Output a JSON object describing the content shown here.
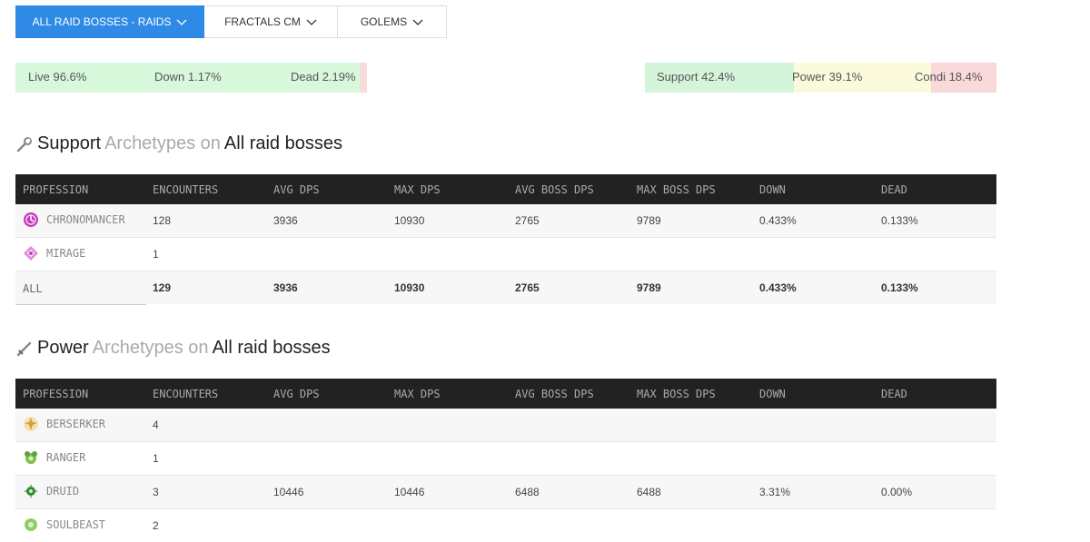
{
  "tabs": [
    {
      "label": "ALL RAID BOSSES - RAIDS",
      "active": true
    },
    {
      "label": "FRACTALS CM",
      "active": false
    },
    {
      "label": "GOLEMS",
      "active": false
    }
  ],
  "status_bar": {
    "live": {
      "label": "Live 96.6%",
      "value": 96.6,
      "color": "#d8f8dc"
    },
    "down": {
      "label": "Down 1.17%",
      "value": 1.17,
      "color": "#d8f8dc"
    },
    "dead": {
      "label": "Dead 2.19%",
      "value": 2.19,
      "color": "#f8dcdc"
    }
  },
  "archetype_bar": {
    "support": {
      "label": "Support 42.4%",
      "value": 42.4,
      "color": "#d4f5da"
    },
    "power": {
      "label": "Power 39.1%",
      "value": 39.1,
      "color": "#fbfbdc"
    },
    "condi": {
      "label": "Condi 18.4%",
      "value": 18.4,
      "color": "#f9d9d9"
    }
  },
  "columns": [
    "PROFESSION",
    "ENCOUNTERS",
    "AVG DPS",
    "MAX DPS",
    "AVG BOSS DPS",
    "MAX BOSS DPS",
    "DOWN",
    "DEAD"
  ],
  "support_section": {
    "title": "Support",
    "mid": "Archetypes on",
    "target": "All raid bosses",
    "rows": [
      {
        "profession": "CHRONOMANCER",
        "icon": "chronomancer-icon",
        "encounters": "128",
        "avg_dps": "3936",
        "max_dps": "10930",
        "avg_boss_dps": "2765",
        "max_boss_dps": "9789",
        "down": "0.433%",
        "dead": "0.133%"
      },
      {
        "profession": "MIRAGE",
        "icon": "mirage-icon",
        "encounters": "1",
        "avg_dps": "",
        "max_dps": "",
        "avg_boss_dps": "",
        "max_boss_dps": "",
        "down": "",
        "dead": ""
      }
    ],
    "all": {
      "label": "ALL",
      "encounters": "129",
      "avg_dps": "3936",
      "max_dps": "10930",
      "avg_boss_dps": "2765",
      "max_boss_dps": "9789",
      "down": "0.433%",
      "dead": "0.133%"
    }
  },
  "power_section": {
    "title": "Power",
    "mid": "Archetypes on",
    "target": "All raid bosses",
    "rows": [
      {
        "profession": "BERSERKER",
        "icon": "berserker-icon",
        "encounters": "4",
        "avg_dps": "",
        "max_dps": "",
        "avg_boss_dps": "",
        "max_boss_dps": "",
        "down": "",
        "dead": ""
      },
      {
        "profession": "RANGER",
        "icon": "ranger-icon",
        "encounters": "1",
        "avg_dps": "",
        "max_dps": "",
        "avg_boss_dps": "",
        "max_boss_dps": "",
        "down": "",
        "dead": ""
      },
      {
        "profession": "DRUID",
        "icon": "druid-icon",
        "encounters": "3",
        "avg_dps": "10446",
        "max_dps": "10446",
        "avg_boss_dps": "6488",
        "max_boss_dps": "6488",
        "down": "3.31%",
        "dead": "0.00%"
      },
      {
        "profession": "SOULBEAST",
        "icon": "soulbeast-icon",
        "encounters": "2",
        "avg_dps": "",
        "max_dps": "",
        "avg_boss_dps": "",
        "max_boss_dps": "",
        "down": "",
        "dead": ""
      }
    ]
  }
}
